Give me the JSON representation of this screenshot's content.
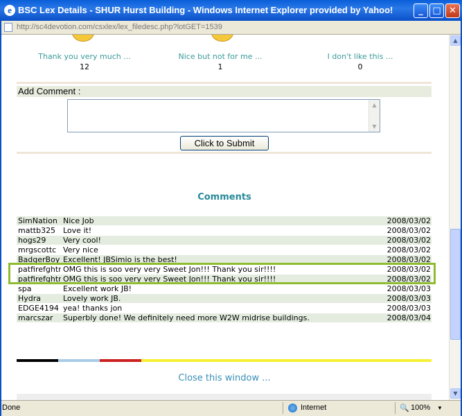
{
  "window": {
    "title": "BSC Lex Details - SHUR Hurst Building - Windows Internet Explorer provided by Yahoo!",
    "minimize": "_",
    "maximize": "□",
    "close": "✕"
  },
  "address": {
    "url": "http://sc4devotion.com/csxlex/lex_filedesc.php?lotGET=1539"
  },
  "votes": [
    {
      "label": "Thank you very much ...",
      "count": "12"
    },
    {
      "label": "Nice but not for me ...",
      "count": "1"
    },
    {
      "label": "I don't like this ...",
      "count": "0"
    }
  ],
  "comment_form": {
    "header": "Add Comment :",
    "submit": "Click to Submit"
  },
  "comments_title": "Comments",
  "comments": [
    {
      "user": "SimNation",
      "text": "Nice Job",
      "date": "2008/03/02"
    },
    {
      "user": "mattb325",
      "text": "Love it!",
      "date": "2008/03/02"
    },
    {
      "user": "hogs29",
      "text": "Very cool!",
      "date": "2008/03/02"
    },
    {
      "user": "mrgscottc",
      "text": "Very nice",
      "date": "2008/03/02"
    },
    {
      "user": "BadgerBoy",
      "text": "Excellent! JBSimio is the best!",
      "date": "2008/03/02"
    },
    {
      "user": "patfirefghtr",
      "text": "OMG this is soo very very Sweet Jon!!! Thank you sir!!!!",
      "date": "2008/03/02"
    },
    {
      "user": "patfirefghtr",
      "text": "OMG this is soo very very Sweet Jon!!! Thank you sir!!!!",
      "date": "2008/03/02"
    },
    {
      "user": "spa",
      "text": "Excellent work JB!",
      "date": "2008/03/03"
    },
    {
      "user": "Hydra",
      "text": "Lovely work JB.",
      "date": "2008/03/03"
    },
    {
      "user": "EDGE4194",
      "text": "yea! thanks jon",
      "date": "2008/03/03"
    },
    {
      "user": "marcszar",
      "text": "Superbly done! We definitely need more W2W midrise buildings.",
      "date": "2008/03/04"
    }
  ],
  "colorbar_colors": [
    "#000000",
    "#a8cbe8",
    "#cc1f1f",
    "#f5f032"
  ],
  "close_link": "Close this window ...",
  "status": {
    "left": "Done",
    "zone": "Internet",
    "zoom": "100%"
  },
  "colors": {
    "title_bar": "#0a5fd8",
    "teal_text": "#3a9a9a",
    "highlight_border": "#8fbc2f"
  }
}
